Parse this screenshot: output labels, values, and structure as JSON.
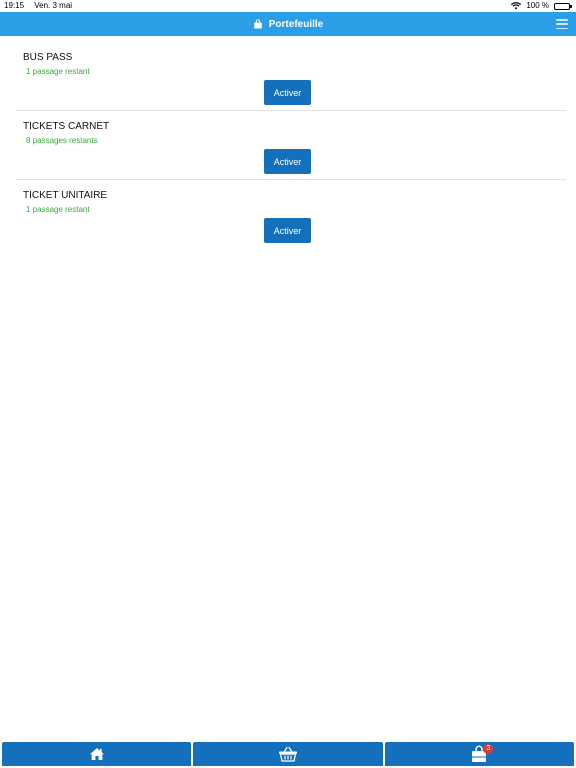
{
  "status_bar": {
    "time": "19:15",
    "date": "Ven. 3 mai",
    "battery": "100 %",
    "wifi_icon": "wifi-icon"
  },
  "header": {
    "title": "Portefeuille",
    "icon": "wallet-bag-icon",
    "menu_icon": "hamburger-menu-icon"
  },
  "wallet": {
    "items": [
      {
        "title": "BUS PASS",
        "remaining": "1 passage restant",
        "button_label": "Activer"
      },
      {
        "title": "TICKETS CARNET",
        "remaining": "8 passages restants",
        "button_label": "Activer"
      },
      {
        "title": "TICKET UNITAIRE",
        "remaining": "1 passage restant",
        "button_label": "Activer"
      }
    ]
  },
  "tab_bar": {
    "tabs": [
      {
        "icon": "home-icon"
      },
      {
        "icon": "basket-icon"
      },
      {
        "icon": "wallet-bag-icon",
        "badge": "3"
      }
    ]
  },
  "colors": {
    "header_bg": "#2a9ee6",
    "button_bg": "#1470bb",
    "remaining_text": "#3bab3b",
    "badge_bg": "#e53935"
  }
}
